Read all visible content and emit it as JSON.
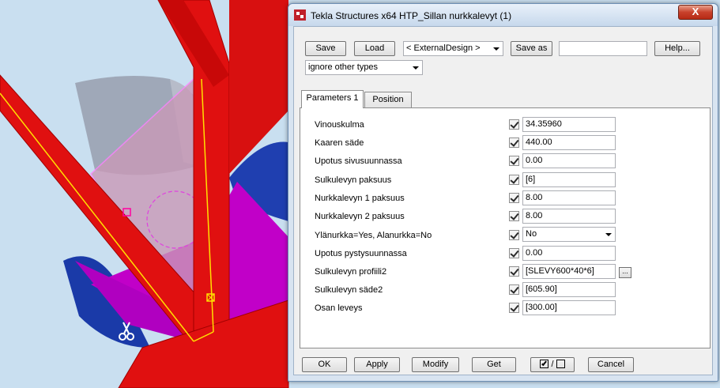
{
  "window": {
    "title": "Tekla Structures x64  HTP_Sillan nurkkalevyt (1)",
    "close_label": "X"
  },
  "toolbar": {
    "save_label": "Save",
    "load_label": "Load",
    "attribute_set": "< ExternalDesign >",
    "save_as_label": "Save as",
    "save_as_value": "",
    "help_label": "Help...",
    "filter_value": "ignore other types"
  },
  "tabs": [
    {
      "label": "Parameters 1",
      "active": true
    },
    {
      "label": "Position",
      "active": false
    }
  ],
  "parameters": [
    {
      "label": "Vinouskulma",
      "checked": true,
      "value": "34.35960",
      "kind": "text"
    },
    {
      "label": "Kaaren säde",
      "checked": true,
      "value": "440.00",
      "kind": "text"
    },
    {
      "label": "Upotus sivusuunnassa",
      "checked": true,
      "value": "0.00",
      "kind": "text"
    },
    {
      "label": "Sulkulevyn paksuus",
      "checked": true,
      "value": "[6]",
      "kind": "text"
    },
    {
      "label": "Nurkkalevyn 1 paksuus",
      "checked": true,
      "value": "8.00",
      "kind": "text"
    },
    {
      "label": "Nurkkalevyn 2 paksuus",
      "checked": true,
      "value": "8.00",
      "kind": "text"
    },
    {
      "label": "Ylänurkka=Yes, Alanurkka=No",
      "checked": true,
      "value": "No",
      "kind": "select"
    },
    {
      "label": "Upotus pystysuunnassa",
      "checked": true,
      "value": "0.00",
      "kind": "text"
    },
    {
      "label": "Sulkulevyn profiili2",
      "checked": true,
      "value": "[SLEVY600*40*6]",
      "kind": "browse",
      "browse_label": "..."
    },
    {
      "label": "Sulkulevyn säde2",
      "checked": true,
      "value": "[605.90]",
      "kind": "text"
    },
    {
      "label": "Osan leveys",
      "checked": true,
      "value": "[300.00]",
      "kind": "text"
    }
  ],
  "footer": {
    "ok_label": "OK",
    "apply_label": "Apply",
    "modify_label": "Modify",
    "get_label": "Get",
    "toggle_label": "/",
    "cancel_label": "Cancel"
  },
  "colors": {
    "beam_red": "#e01010",
    "plate_magenta": "#cc00cc",
    "tube_blue": "#1a3fb3",
    "background": "#c9dff0"
  },
  "icons": [
    "tekla-app-icon",
    "scissors-icon",
    "checkbox-icon",
    "chevron-down-icon",
    "browse-icon"
  ]
}
